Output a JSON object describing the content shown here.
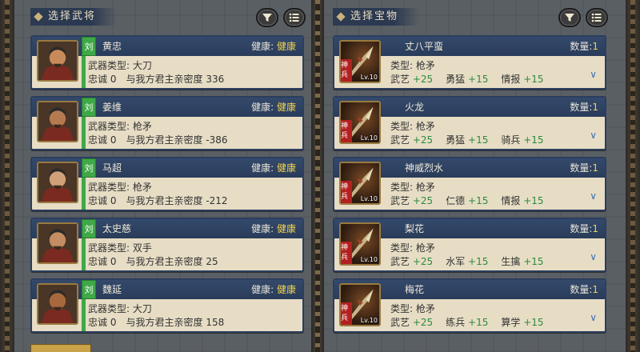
{
  "left_panel": {
    "title": "选择武将",
    "filter_icon": "filter-icon",
    "list_icon": "list-icon"
  },
  "right_panel": {
    "title": "选择宝物",
    "filter_icon": "filter-icon",
    "list_icon": "list-icon"
  },
  "generals": [
    {
      "name": "黄忠",
      "faction": "刘",
      "health_label": "健康:",
      "health_value": "健康",
      "weapon_label": "武器类型:",
      "weapon": "大刀",
      "loyalty_label": "忠诚",
      "loyalty": "0",
      "intimacy_label": "与我方君主亲密度",
      "intimacy": "336"
    },
    {
      "name": "姜维",
      "faction": "刘",
      "health_label": "健康:",
      "health_value": "健康",
      "weapon_label": "武器类型:",
      "weapon": "枪矛",
      "loyalty_label": "忠诚",
      "loyalty": "0",
      "intimacy_label": "与我方君主亲密度",
      "intimacy": "-386"
    },
    {
      "name": "马超",
      "faction": "刘",
      "health_label": "健康:",
      "health_value": "健康",
      "weapon_label": "武器类型:",
      "weapon": "枪矛",
      "loyalty_label": "忠诚",
      "loyalty": "0",
      "intimacy_label": "与我方君主亲密度",
      "intimacy": "-212"
    },
    {
      "name": "太史慈",
      "faction": "刘",
      "health_label": "健康:",
      "health_value": "健康",
      "weapon_label": "武器类型:",
      "weapon": "双手",
      "loyalty_label": "忠诚",
      "loyalty": "0",
      "intimacy_label": "与我方君主亲密度",
      "intimacy": "25"
    },
    {
      "name": "魏延",
      "faction": "刘",
      "health_label": "健康:",
      "health_value": "健康",
      "weapon_label": "武器类型:",
      "weapon": "大刀",
      "loyalty_label": "忠诚",
      "loyalty": "0",
      "intimacy_label": "与我方君主亲密度",
      "intimacy": "158"
    }
  ],
  "treasures": [
    {
      "name": "丈八平蛮",
      "badge": "神兵",
      "level": "Lv.10",
      "qty_label": "数量:",
      "qty": "1",
      "type_label": "类型:",
      "type": "枪矛",
      "stats": [
        {
          "k": "武艺",
          "v": "+25"
        },
        {
          "k": "勇猛",
          "v": "+15"
        },
        {
          "k": "情报",
          "v": "+15"
        }
      ]
    },
    {
      "name": "火龙",
      "badge": "神兵",
      "level": "Lv.10",
      "qty_label": "数量:",
      "qty": "1",
      "type_label": "类型:",
      "type": "枪矛",
      "stats": [
        {
          "k": "武艺",
          "v": "+25"
        },
        {
          "k": "勇猛",
          "v": "+15"
        },
        {
          "k": "骑兵",
          "v": "+15"
        }
      ]
    },
    {
      "name": "神威烈水",
      "badge": "神兵",
      "level": "Lv.10",
      "qty_label": "数量:",
      "qty": "1",
      "type_label": "类型:",
      "type": "枪矛",
      "stats": [
        {
          "k": "武艺",
          "v": "+25"
        },
        {
          "k": "仁德",
          "v": "+15"
        },
        {
          "k": "情报",
          "v": "+15"
        }
      ]
    },
    {
      "name": "梨花",
      "badge": "神兵",
      "level": "Lv.10",
      "qty_label": "数量:",
      "qty": "1",
      "type_label": "类型:",
      "type": "枪矛",
      "stats": [
        {
          "k": "武艺",
          "v": "+25"
        },
        {
          "k": "水军",
          "v": "+15"
        },
        {
          "k": "生擒",
          "v": "+15"
        }
      ]
    },
    {
      "name": "梅花",
      "badge": "神兵",
      "level": "Lv.10",
      "qty_label": "数量:",
      "qty": "1",
      "type_label": "类型:",
      "type": "枪矛",
      "stats": [
        {
          "k": "武艺",
          "v": "+25"
        },
        {
          "k": "练兵",
          "v": "+15"
        },
        {
          "k": "算学",
          "v": "+15"
        }
      ]
    }
  ],
  "colors": {
    "card_header": "#2a3c5a",
    "card_body": "#e7ddc5",
    "faction_green": "#3fa847",
    "health_yellow": "#f2d24a",
    "stat_green": "#2b8a3e",
    "badge_red": "#b32020"
  }
}
